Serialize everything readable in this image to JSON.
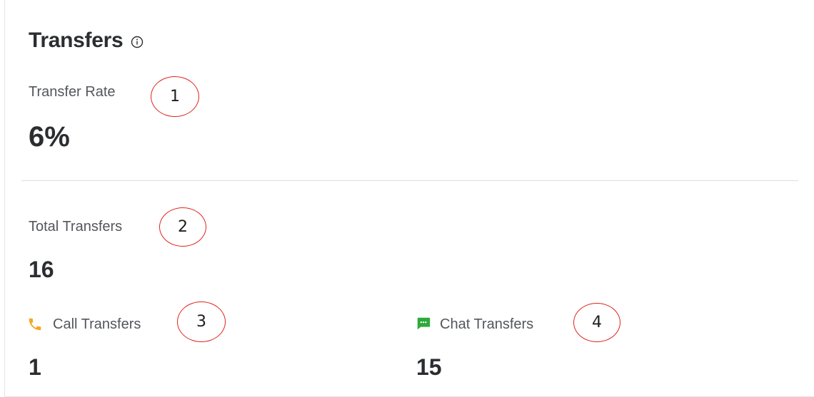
{
  "widget": {
    "title": "Transfers",
    "info_icon": "info-icon"
  },
  "transfer_rate": {
    "label": "Transfer Rate",
    "value": "6%",
    "marker": "1"
  },
  "total_transfers": {
    "label": "Total Transfers",
    "value": "16",
    "marker": "2"
  },
  "call_transfers": {
    "icon": "phone-icon",
    "icon_color": "#f5a623",
    "label": "Call Transfers",
    "value": "1",
    "marker": "3"
  },
  "chat_transfers": {
    "icon": "chat-icon",
    "icon_color": "#2eaa3a",
    "label": "Chat Transfers",
    "value": "15",
    "marker": "4"
  },
  "colors": {
    "marker_red": "#e0241b",
    "divider": "#dcdee0",
    "text_dark": "#2b2d31",
    "text_label": "#53565b"
  }
}
